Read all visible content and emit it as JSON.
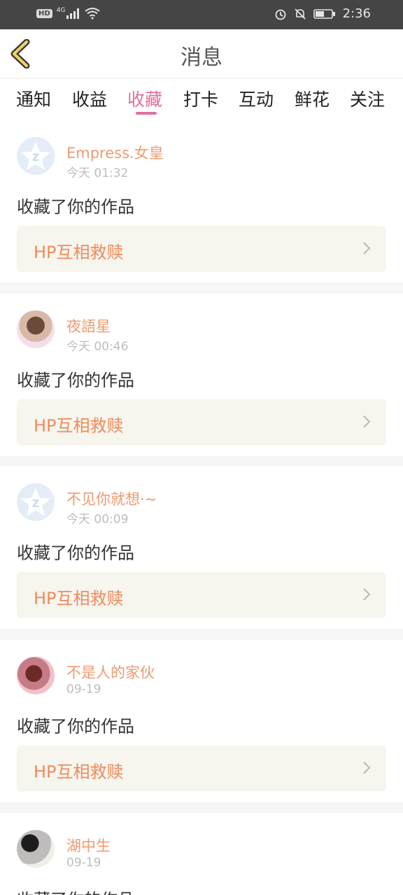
{
  "status_bar": {
    "hd": "HD",
    "network": "4G",
    "time": "2:36"
  },
  "header": {
    "title": "消息"
  },
  "tabs": [
    {
      "label": "通知"
    },
    {
      "label": "收益"
    },
    {
      "label": "收藏"
    },
    {
      "label": "打卡"
    },
    {
      "label": "互动"
    },
    {
      "label": "鲜花"
    },
    {
      "label": "关注"
    }
  ],
  "active_tab": "收藏",
  "items": [
    {
      "name": "Empress.女皇",
      "time": "今天 01:32",
      "action": "收藏了你的作品",
      "work": "HP互相救赎"
    },
    {
      "name": "夜語星",
      "time": "今天 00:46",
      "action": "收藏了你的作品",
      "work": "HP互相救赎"
    },
    {
      "name": "不见你就想·~",
      "time": "今天 00:09",
      "action": "收藏了你的作品",
      "work": "HP互相救赎"
    },
    {
      "name": "不是人的家伙",
      "time": "09-19",
      "action": "收藏了你的作品",
      "work": "HP互相救赎"
    },
    {
      "name": "湖中生",
      "time": "09-19",
      "action": "收藏了你的作品",
      "work": ""
    }
  ],
  "colors": {
    "accent": "#e06fa0",
    "name": "#ef9a6f",
    "work_text": "#f08b5a",
    "work_bg": "#f6f5ee",
    "statusbar": "#454545"
  }
}
